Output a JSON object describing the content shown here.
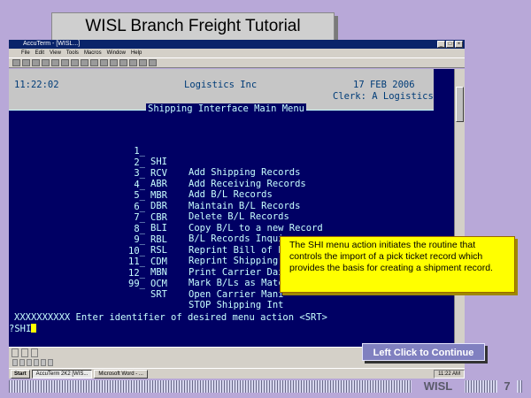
{
  "slide": {
    "title": "WISL Branch Freight Tutorial",
    "footer_label": "WISL",
    "page_number": "7",
    "continue_label": "Left Click to Continue"
  },
  "terminal_window": {
    "title": "AccuTerm - [WISL...]",
    "menu_items": [
      "File",
      "Edit",
      "View",
      "Tools",
      "Macros",
      "Window",
      "Help"
    ]
  },
  "screen": {
    "time": "11:22:02",
    "company": "Logistics Inc",
    "date": "17 FEB 2006",
    "clerk": "Clerk: A Logistics",
    "menu_title": "Shipping Interface Main Menu",
    "items": [
      {
        "num": "1_",
        "code": "SHI",
        "desc": "Add Shipping Records"
      },
      {
        "num": "2_",
        "code": "RCV",
        "desc": "Add Receiving Records"
      },
      {
        "num": "3_",
        "code": "ABR",
        "desc": "Add B/L Records"
      },
      {
        "num": "4_",
        "code": "MBR",
        "desc": "Maintain B/L Records"
      },
      {
        "num": "5_",
        "code": "DBR",
        "desc": "Delete B/L Records"
      },
      {
        "num": "6_",
        "code": "CBR",
        "desc": "Copy B/L to a new Record"
      },
      {
        "num": "7_",
        "code": "BLI",
        "desc": "B/L Records Inquiry"
      },
      {
        "num": "8_",
        "code": "RBL",
        "desc": "Reprint Bill of Lading"
      },
      {
        "num": "9_",
        "code": "RSL",
        "desc": "Reprint Shipping Labels"
      },
      {
        "num": "10_",
        "code": "CDM",
        "desc": "Print Carrier Dai"
      },
      {
        "num": "11_",
        "code": "MBN",
        "desc": "Mark B/Ls as Matc"
      },
      {
        "num": "12_",
        "code": "OCM",
        "desc": "Open Carrier Mani"
      },
      {
        "num": "99_",
        "code": "SRT",
        "desc": "STOP Shipping Int"
      }
    ],
    "prompt": "XXXXXXXXXX Enter identifier of desired menu action <SRT>",
    "input_value": "?SHI"
  },
  "callout_text": "The SHI menu action initiates the routine that controls the import of a pick ticket record which provides the basis for creating a shipment record.",
  "taskbar": {
    "start": "Start",
    "tasks": [
      "AccuTerm 2K2 [WIS...",
      "Microsoft Word - ..."
    ],
    "clock": "11:22 AM"
  },
  "colors": {
    "slide_bg": "#b8a8d8",
    "terminal_bg": "#000064",
    "terminal_text": "#c8ffff",
    "callout_bg": "#ffff00",
    "continue_bg": "#8080c0"
  }
}
